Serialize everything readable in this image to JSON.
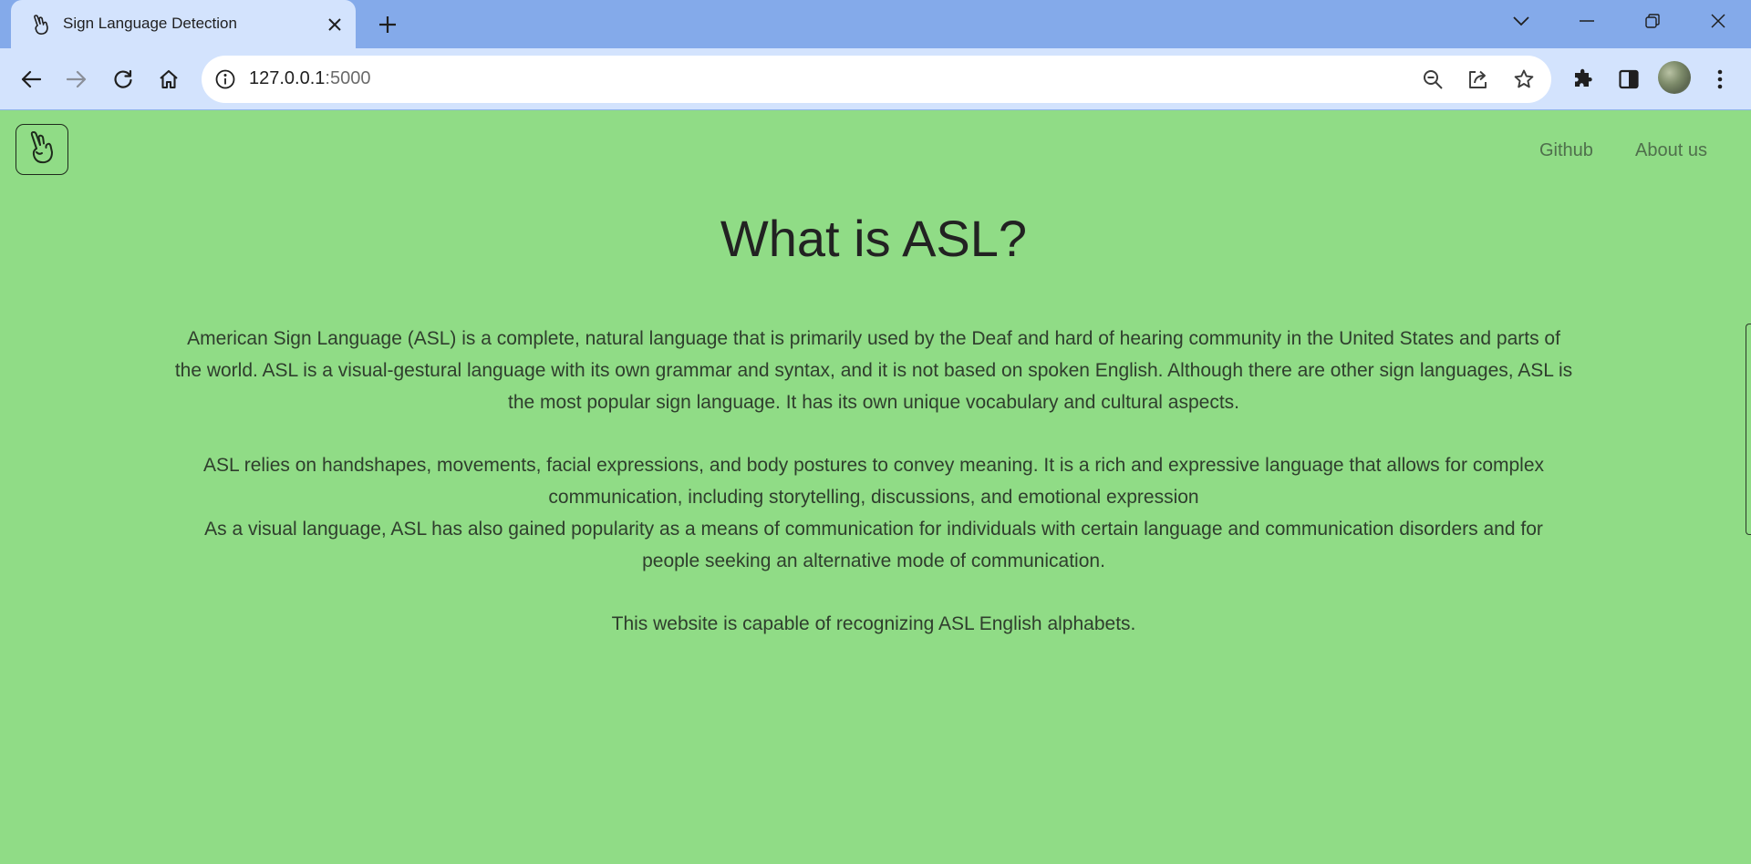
{
  "browser": {
    "tab_title": "Sign Language Detection",
    "url_host": "127.0.0.1",
    "url_port": ":5000"
  },
  "nav": {
    "links": [
      "Github",
      "About us"
    ]
  },
  "main": {
    "headline": "What is ASL?",
    "paragraphs": [
      "American Sign Language (ASL) is a complete, natural language that is primarily used by the Deaf and hard of hearing community in the United States and parts of the world. ASL is a visual-gestural language with its own grammar and syntax, and it is not based on spoken English. Although there are other sign languages, ASL is the most popular sign language. It has its own unique vocabulary and cultural aspects.",
      "ASL relies on handshapes, movements, facial expressions, and body postures to convey meaning. It is a rich and expressive language that allows for complex communication, including storytelling, discussions, and emotional expression",
      "As a visual language, ASL has also gained popularity as a means of communication for individuals with certain language and communication disorders and for people seeking an alternative mode of communication.",
      "This website is capable of recognizing ASL English alphabets."
    ]
  },
  "colors": {
    "page_background": "#90dc86",
    "tabstrip_background": "#84aaea",
    "toolbar_background": "#d3e3fd"
  }
}
